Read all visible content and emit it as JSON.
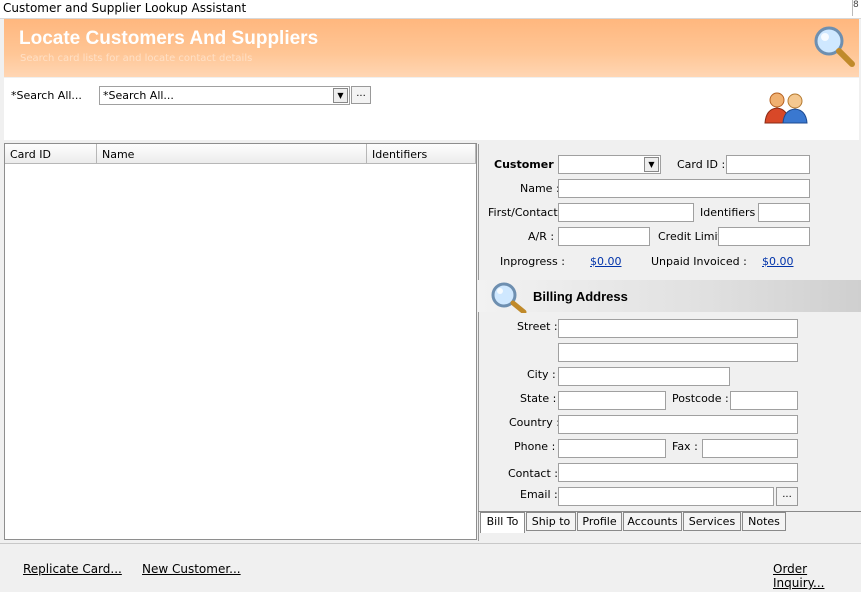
{
  "window": {
    "title": "Customer and Supplier Lookup Assistant"
  },
  "banner": {
    "title": "Locate Customers And Suppliers",
    "subtitle": "Search card lists for and locate contact details"
  },
  "search": {
    "label": "*Search All...",
    "value": "*Search All...",
    "button": "..."
  },
  "list": {
    "columns": [
      "Card ID",
      "Name",
      "Identifiers"
    ],
    "rows": []
  },
  "details": {
    "type_label": "Customer :",
    "type_value": "",
    "card_id_label": "Card ID :",
    "name_label": "Name :",
    "contact_label": "First/Contact :",
    "identifiers_label": "Identifiers :",
    "ar_label": "A/R :",
    "credit_limit_label": "Credit Limit :",
    "inprogress_label": "Inprogress :",
    "inprogress_value": "$0.00",
    "unpaid_label": "Unpaid Invoiced :",
    "unpaid_value": "$0.00"
  },
  "billing": {
    "title": "Billing Address",
    "street_label": "Street :",
    "city_label": "City :",
    "state_label": "State :",
    "postcode_label": "Postcode :",
    "country_label": "Country :",
    "phone_label": "Phone :",
    "fax_label": "Fax :",
    "contact_label": "Contact :",
    "email_label": "Email :",
    "email_button": "..."
  },
  "tabs": [
    "Bill To",
    "Ship to",
    "Profile",
    "Accounts",
    "Services",
    "Notes"
  ],
  "footer": {
    "replicate": "Replicate Card...",
    "new_customer": "New Customer...",
    "order_inquiry": "Order Inquiry..."
  },
  "colors": {
    "banner": "#ffb77e",
    "link": "#0033aa"
  },
  "icons": [
    "magnifier-icon",
    "users-icon",
    "dropdown-arrow-icon"
  ]
}
